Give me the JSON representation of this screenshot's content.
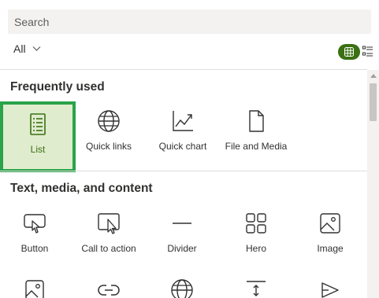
{
  "search": {
    "placeholder": "Search"
  },
  "filter": {
    "label": "All"
  },
  "view_toggle": {
    "grid_icon": "grid-icon",
    "list_icon": "list-view-icon",
    "active_color": "#3b7013"
  },
  "sections": [
    {
      "title": "Frequently used",
      "items": [
        {
          "label": "List",
          "icon": "list-icon",
          "selected": true
        },
        {
          "label": "Quick links",
          "icon": "globe-icon"
        },
        {
          "label": "Quick chart",
          "icon": "line-chart-icon"
        },
        {
          "label": "File and Media",
          "icon": "document-icon"
        }
      ]
    },
    {
      "title": "Text, media, and content",
      "items": [
        {
          "label": "Button",
          "icon": "button-pointer-icon"
        },
        {
          "label": "Call to action",
          "icon": "call-to-action-icon"
        },
        {
          "label": "Divider",
          "icon": "divider-icon"
        },
        {
          "label": "Hero",
          "icon": "hero-layout-icon"
        },
        {
          "label": "Image",
          "icon": "image-icon"
        },
        {
          "label": "",
          "icon": "image-gallery-icon"
        },
        {
          "label": "",
          "icon": "link-icon"
        },
        {
          "label": "",
          "icon": "globe-icon"
        },
        {
          "label": "",
          "icon": "spacer-icon"
        },
        {
          "label": "",
          "icon": "stream-icon"
        }
      ]
    }
  ],
  "colors": {
    "selected_bg": "#dfeccd",
    "selected_border": "#2aa34a",
    "accent": "#3b7013"
  }
}
